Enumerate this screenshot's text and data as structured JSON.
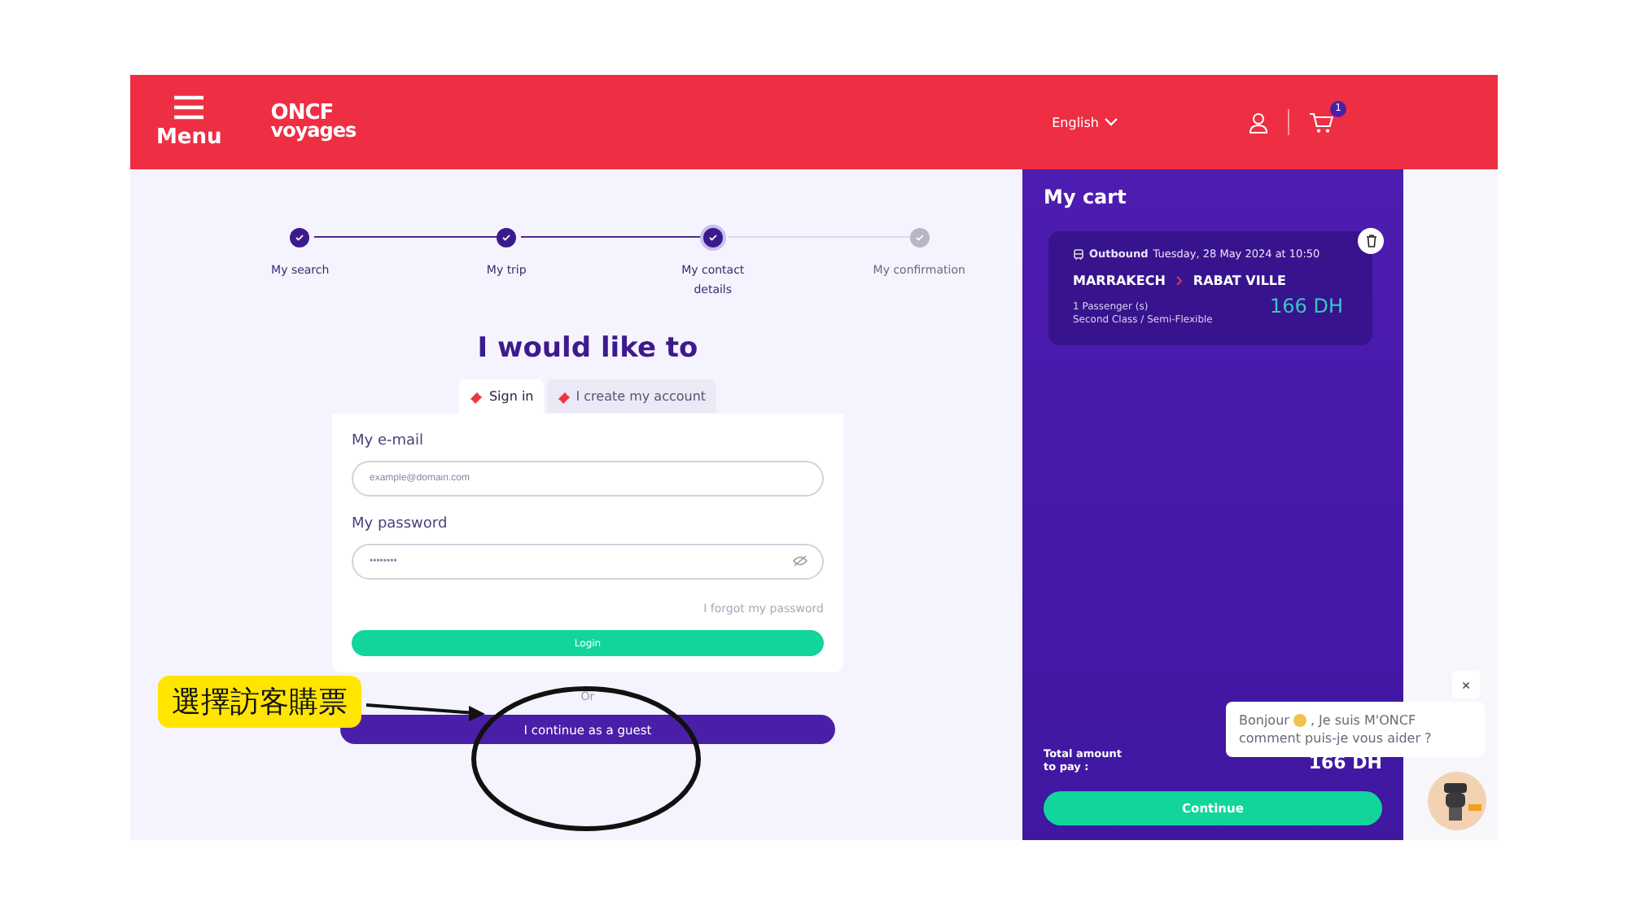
{
  "header": {
    "menu_label": "Menu",
    "logo_top": "ONCF",
    "logo_bottom": "voyages",
    "language": "English",
    "cart_count": "1"
  },
  "steps": [
    {
      "label": "My search",
      "completed": true,
      "selected": false
    },
    {
      "label": "My trip",
      "completed": true,
      "selected": false
    },
    {
      "label": "My contact details",
      "completed": true,
      "selected": true
    },
    {
      "label": "My confirmation",
      "completed": false,
      "selected": false
    }
  ],
  "heading": "I would like to",
  "tabs": [
    {
      "label": "Sign in",
      "selected": true
    },
    {
      "label": "I create my account",
      "selected": false
    }
  ],
  "form": {
    "email_label": "My e-mail",
    "email_placeholder": "example@domain.com",
    "password_label": "My password",
    "password_placeholder": "••••••••",
    "forgot": "I forgot my password",
    "login": "Login"
  },
  "or": "Or",
  "guest_button": "I continue as a guest",
  "cart": {
    "title": "My cart",
    "direction": "Outbound",
    "date": "Tuesday, 28 May 2024 at 10:50",
    "from": "MARRAKECH",
    "to": "RABAT VILLE",
    "passengers": "1 Passenger (s)",
    "fare": "Second Class / Semi-Flexible",
    "price": "166 DH",
    "total_label": "Total amount to pay :",
    "total": "166 DH",
    "continue": "Continue"
  },
  "chat": {
    "close": "×",
    "greeting": "Bonjour",
    "message_line1": ", Je suis M'ONCF",
    "message_line2": "comment puis-je vous aider ?"
  },
  "annotation": {
    "label": "選擇訪客購票"
  }
}
